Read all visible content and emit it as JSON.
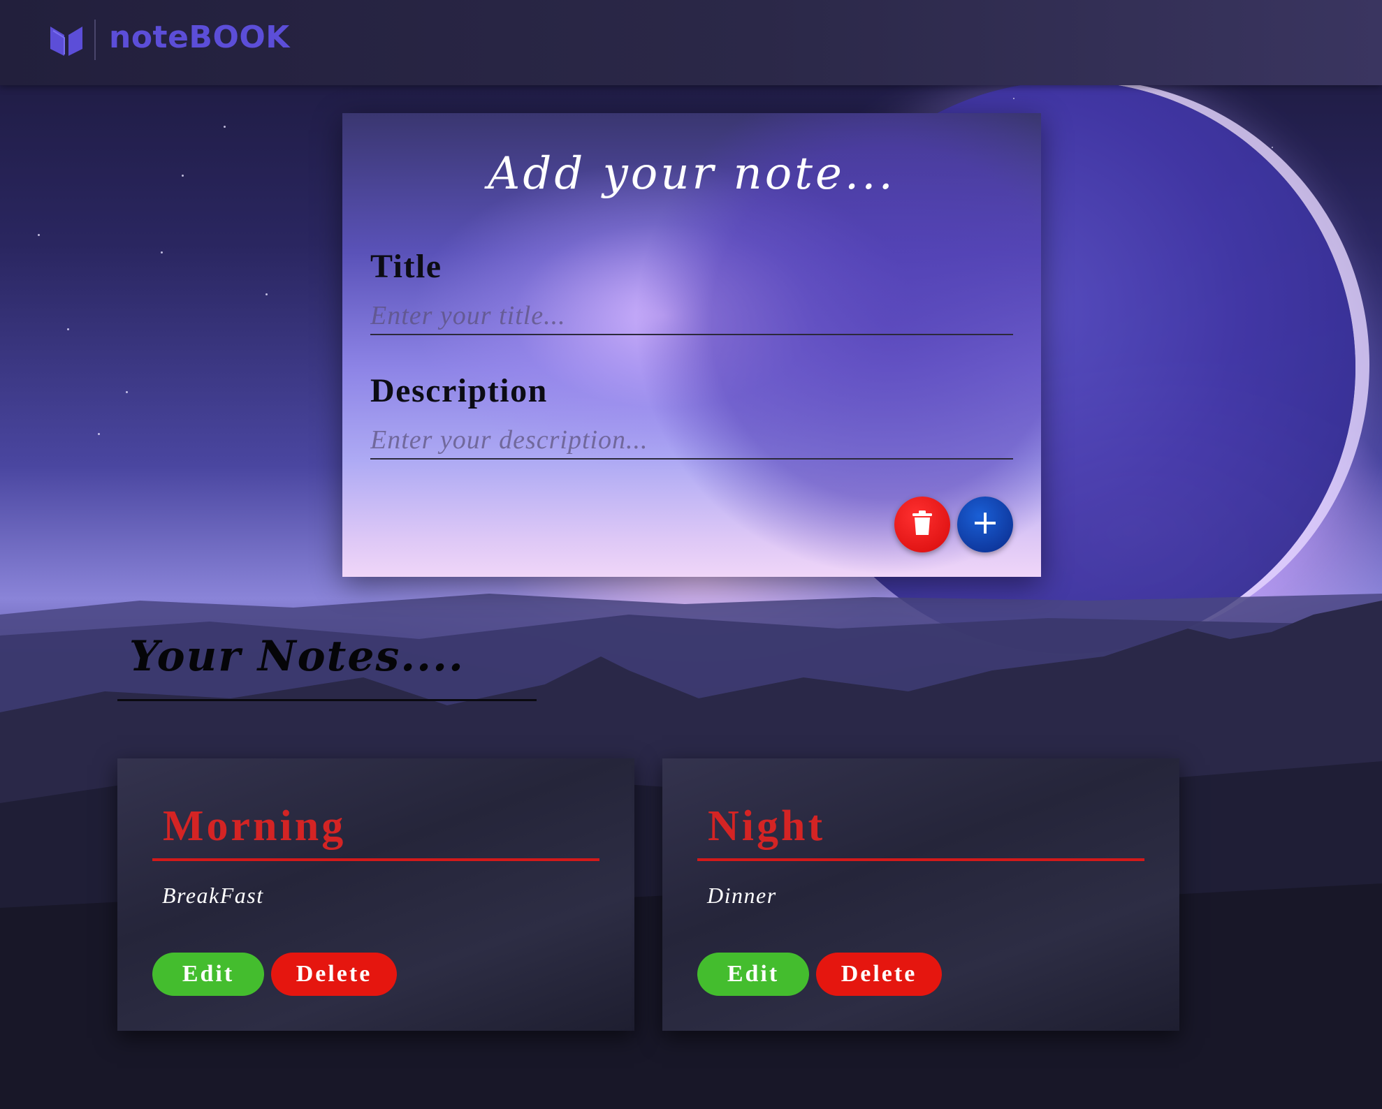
{
  "app": {
    "brand": "noteBOOK"
  },
  "composer": {
    "heading": "Add your note...",
    "title_label": "Title",
    "title_placeholder": "Enter your title...",
    "title_value": "",
    "description_label": "Description",
    "description_placeholder": "Enter your description...",
    "description_value": "",
    "clear_icon": "trash-icon",
    "add_icon": "plus-icon"
  },
  "notes_section": {
    "heading": "Your Notes....",
    "notes": [
      {
        "title": "Morning",
        "description": "BreakFast",
        "edit_label": "Edit",
        "delete_label": "Delete"
      },
      {
        "title": "Night",
        "description": "Dinner",
        "edit_label": "Edit",
        "delete_label": "Delete"
      }
    ]
  },
  "colors": {
    "brand": "#5c4ed8",
    "note_title": "#d42424",
    "edit_button": "#44bd2e",
    "delete_button": "#e5160f",
    "clear_button": "#e01010",
    "add_button": "#0d3aa8"
  }
}
